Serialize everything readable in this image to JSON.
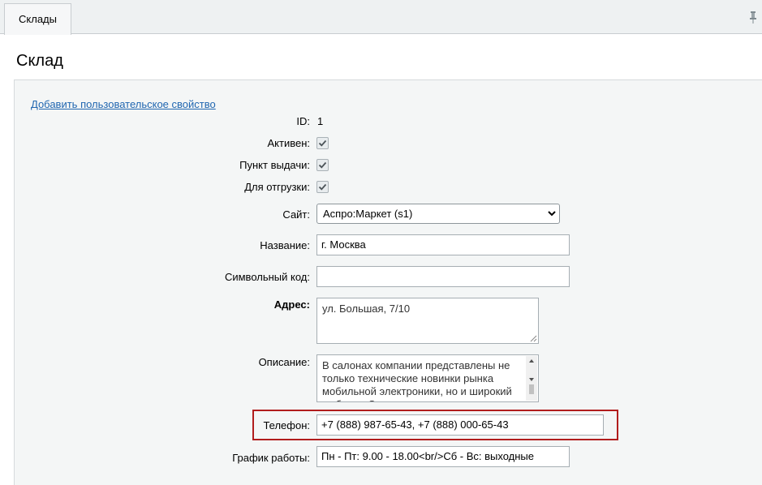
{
  "tabs": [
    {
      "label": "Склады"
    }
  ],
  "page": {
    "title": "Склад"
  },
  "form": {
    "add_property_link": "Добавить пользовательское свойство",
    "id": {
      "label": "ID:",
      "value": "1"
    },
    "active": {
      "label": "Активен:",
      "checked": true
    },
    "pickup_point": {
      "label": "Пункт выдачи:",
      "checked": true
    },
    "for_shipping": {
      "label": "Для отгрузки:",
      "checked": true
    },
    "site": {
      "label": "Сайт:",
      "value": "Аспро:Маркет (s1)"
    },
    "name": {
      "label": "Название:",
      "value": "г. Москва"
    },
    "code": {
      "label": "Символьный код:",
      "value": ""
    },
    "address": {
      "label": "Адрес:",
      "value": "ул. Большая, 7/10"
    },
    "description": {
      "label": "Описание:",
      "value": "В салонах компании представлены не только технические новинки рынка мобильной электроники, но и широкий выбор ... О"
    },
    "phone": {
      "label": "Телефон:",
      "value": "+7 (888) 987-65-43, +7 (888) 000-65-43"
    },
    "schedule": {
      "label": "График работы:",
      "value": "Пн - Пт: 9.00 - 18.00<br/>Сб - Вс: выходные"
    }
  },
  "colors": {
    "link": "#2066b0",
    "highlight_border": "#b11d1d",
    "panel_bg": "#f4f6f6"
  }
}
